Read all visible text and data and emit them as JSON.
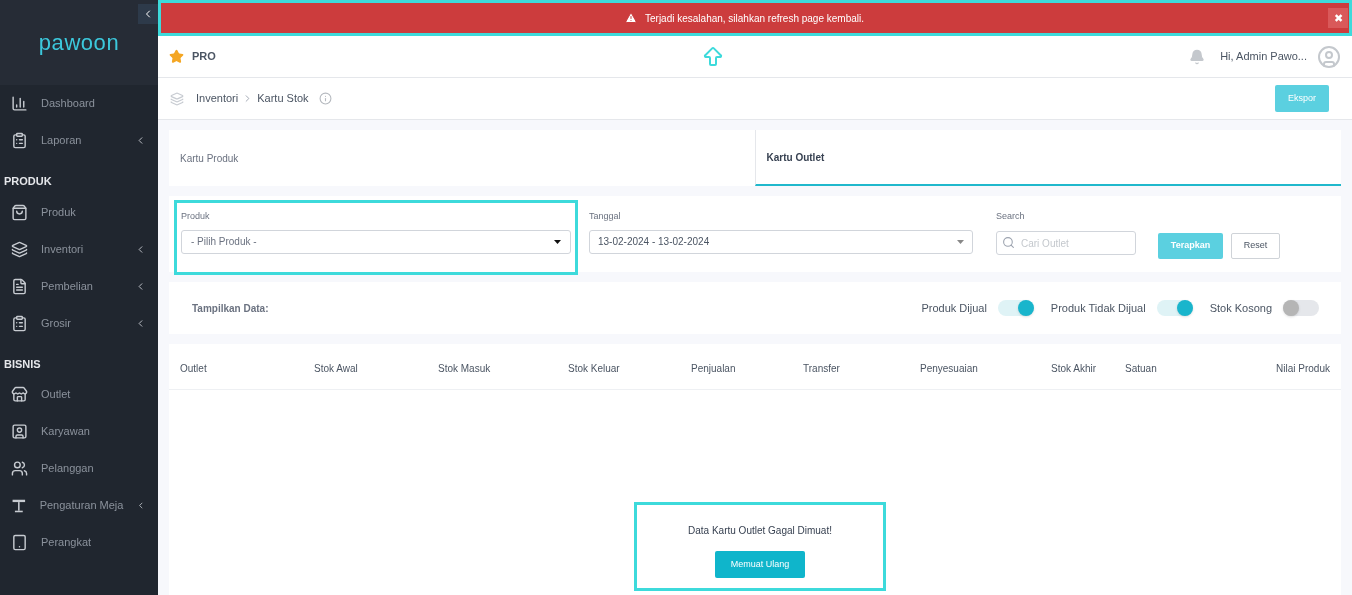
{
  "alert": {
    "message": "Terjadi kesalahan, silahkan refresh page kembali.",
    "close": "✖"
  },
  "sidebar": {
    "logo": "pawoon",
    "groups": [
      {
        "items": [
          {
            "label": "Dashboard",
            "has_submenu": false
          },
          {
            "label": "Laporan",
            "has_submenu": true
          }
        ]
      },
      {
        "title": "PRODUK",
        "items": [
          {
            "label": "Produk",
            "has_submenu": false
          },
          {
            "label": "Inventori",
            "has_submenu": true
          },
          {
            "label": "Pembelian",
            "has_submenu": true
          },
          {
            "label": "Grosir",
            "has_submenu": true
          }
        ]
      },
      {
        "title": "BISNIS",
        "items": [
          {
            "label": "Outlet",
            "has_submenu": false
          },
          {
            "label": "Karyawan",
            "has_submenu": false
          },
          {
            "label": "Pelanggan",
            "has_submenu": false
          },
          {
            "label": "Pengaturan Meja",
            "has_submenu": true
          },
          {
            "label": "Perangkat",
            "has_submenu": false
          }
        ]
      }
    ]
  },
  "header": {
    "plan": "PRO",
    "user": "Hi, Admin Pawo..."
  },
  "breadcrumb": [
    "Inventori",
    "Kartu Stok"
  ],
  "export_button": "Ekspor",
  "tabs": [
    {
      "label": "Kartu Produk",
      "selected": false
    },
    {
      "label": "Kartu Outlet",
      "selected": true
    }
  ],
  "filters": {
    "produk": {
      "label": "Produk",
      "value": "- Pilih Produk -"
    },
    "tanggal": {
      "label": "Tanggal",
      "value": "13-02-2024 - 13-02-2024"
    },
    "search": {
      "label": "Search",
      "placeholder": "Cari Outlet"
    },
    "apply": "Terapkan",
    "reset": "Reset"
  },
  "display": {
    "label": "Tampilkan Data:",
    "toggles": [
      {
        "label": "Produk Dijual",
        "on": true
      },
      {
        "label": "Produk Tidak Dijual",
        "on": true
      },
      {
        "label": "Stok Kosong",
        "on": false
      }
    ]
  },
  "table": {
    "columns": [
      "Outlet",
      "Stok Awal",
      "Stok Masuk",
      "Stok Keluar",
      "Penjualan",
      "Transfer",
      "Penyesuaian",
      "Stok Akhir",
      "Satuan",
      "Nilai Produk"
    ]
  },
  "error_box": {
    "message": "Data Kartu Outlet Gagal Dimuat!",
    "button": "Memuat Ulang"
  }
}
